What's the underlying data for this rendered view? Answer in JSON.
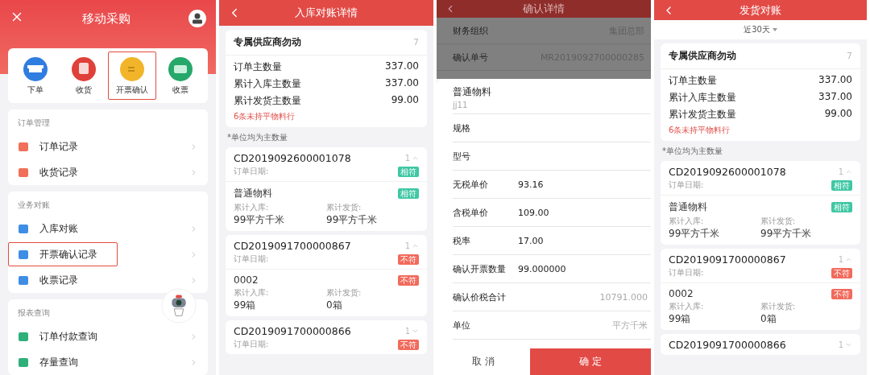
{
  "home": {
    "title": "移动采购",
    "shortcuts": [
      {
        "label": "下单",
        "color": "#2f7de1",
        "selected": false
      },
      {
        "label": "收货",
        "color": "#e0403a",
        "selected": false
      },
      {
        "label": "开票确认",
        "color": "#f2b52a",
        "selected": true
      },
      {
        "label": "收票",
        "color": "#26a86b",
        "selected": false
      }
    ],
    "sections": [
      {
        "title": "订单管理",
        "items": [
          {
            "label": "订单记录",
            "color": "#f0705a",
            "selected": false
          },
          {
            "label": "收货记录",
            "color": "#f0705a",
            "selected": false
          }
        ]
      },
      {
        "title": "业务对账",
        "items": [
          {
            "label": "入库对账",
            "color": "#3f8ee6",
            "selected": false
          },
          {
            "label": "开票确认记录",
            "color": "#3f8ee6",
            "selected": true
          },
          {
            "label": "收票记录",
            "color": "#3f8ee6",
            "selected": false
          }
        ]
      },
      {
        "title": "报表查询",
        "items": [
          {
            "label": "订单付款查询",
            "color": "#2fb07a",
            "selected": false
          },
          {
            "label": "存量查询",
            "color": "#2fb07a",
            "selected": false
          }
        ]
      }
    ]
  },
  "inbound": {
    "title": "入库对账详情",
    "summary": {
      "supplier": "专属供应商勿动",
      "count": "7",
      "rows": [
        {
          "label": "订单主数量",
          "value": "337.00"
        },
        {
          "label": "累计入库主数量",
          "value": "337.00"
        },
        {
          "label": "累计发货主数量",
          "value": "99.00"
        }
      ],
      "warning": "6条未持平物料行"
    },
    "note": "*单位均为主数量",
    "orders": [
      {
        "id": "CD2019092600001078",
        "count": "1",
        "expanded": true,
        "date_label": "订单日期:",
        "badge": {
          "text": "相符",
          "color": "#3fc7a4"
        },
        "item": {
          "name": "普通物料",
          "badge": {
            "text": "相符",
            "color": "#3fc7a4"
          },
          "in_label": "累计入库:",
          "in_value": "99平方千米",
          "out_label": "累计发货:",
          "out_value": "99平方千米"
        }
      },
      {
        "id": "CD2019091700000867",
        "count": "1",
        "expanded": true,
        "date_label": "订单日期:",
        "badge": {
          "text": "不符",
          "color": "#f26a5c"
        },
        "item": {
          "name": "0002",
          "badge": {
            "text": "不符",
            "color": "#f26a5c"
          },
          "in_label": "累计入库:",
          "in_value": "99箱",
          "out_label": "累计发货:",
          "out_value": "0箱"
        }
      },
      {
        "id": "CD2019091700000866",
        "count": "1",
        "expanded": false,
        "date_label": "订单日期:",
        "badge": {
          "text": "不符",
          "color": "#f26a5c"
        }
      }
    ]
  },
  "confirm": {
    "title": "确认详情",
    "rows": [
      {
        "label": "财务组织",
        "value": "集团总部"
      },
      {
        "label": "确认单号",
        "value": "MR2019092700000285"
      }
    ],
    "sheet": {
      "title": "普通物料",
      "subtitle": "jj11",
      "fields": [
        {
          "label": "规格"
        },
        {
          "label": "型号"
        },
        {
          "label": "无税单价",
          "value": "93.16",
          "kind": "input"
        },
        {
          "label": "含税单价",
          "value": "109.00",
          "kind": "input"
        },
        {
          "label": "税率",
          "value": "17.00",
          "kind": "input"
        },
        {
          "label": "确认开票数量",
          "value": "99.000000",
          "kind": "input"
        },
        {
          "label": "确认价税合计",
          "value": "10791.000",
          "kind": "readonly"
        },
        {
          "label": "单位",
          "value": "平方千米",
          "kind": "readonly"
        }
      ],
      "cancel": "取 消",
      "ok": "确 定"
    }
  },
  "shipping": {
    "title": "发货对账",
    "filter": "近30天",
    "summary": {
      "supplier": "专属供应商勿动",
      "count": "7",
      "rows": [
        {
          "label": "订单主数量",
          "value": "337.00"
        },
        {
          "label": "累计入库主数量",
          "value": "337.00"
        },
        {
          "label": "累计发货主数量",
          "value": "99.00"
        }
      ],
      "warning": "6条未持平物料行"
    },
    "note": "*单位均为主数量",
    "orders": [
      {
        "id": "CD2019092600001078",
        "count": "1",
        "expanded": true,
        "date_label": "订单日期:",
        "badge": {
          "text": "相符",
          "color": "#3fc7a4"
        },
        "item": {
          "name": "普通物料",
          "badge": {
            "text": "相符",
            "color": "#3fc7a4"
          },
          "in_label": "累计入库:",
          "in_value": "99平方千米",
          "out_label": "累计发货:",
          "out_value": "99平方千米"
        }
      },
      {
        "id": "CD2019091700000867",
        "count": "1",
        "expanded": true,
        "date_label": "订单日期:",
        "badge": {
          "text": "不符",
          "color": "#f26a5c"
        },
        "item": {
          "name": "0002",
          "badge": {
            "text": "不符",
            "color": "#f26a5c"
          },
          "in_label": "累计入库:",
          "in_value": "99箱",
          "out_label": "累计发货:",
          "out_value": "0箱"
        }
      },
      {
        "id": "CD2019091700000866",
        "count": "1",
        "expanded": false
      }
    ]
  }
}
